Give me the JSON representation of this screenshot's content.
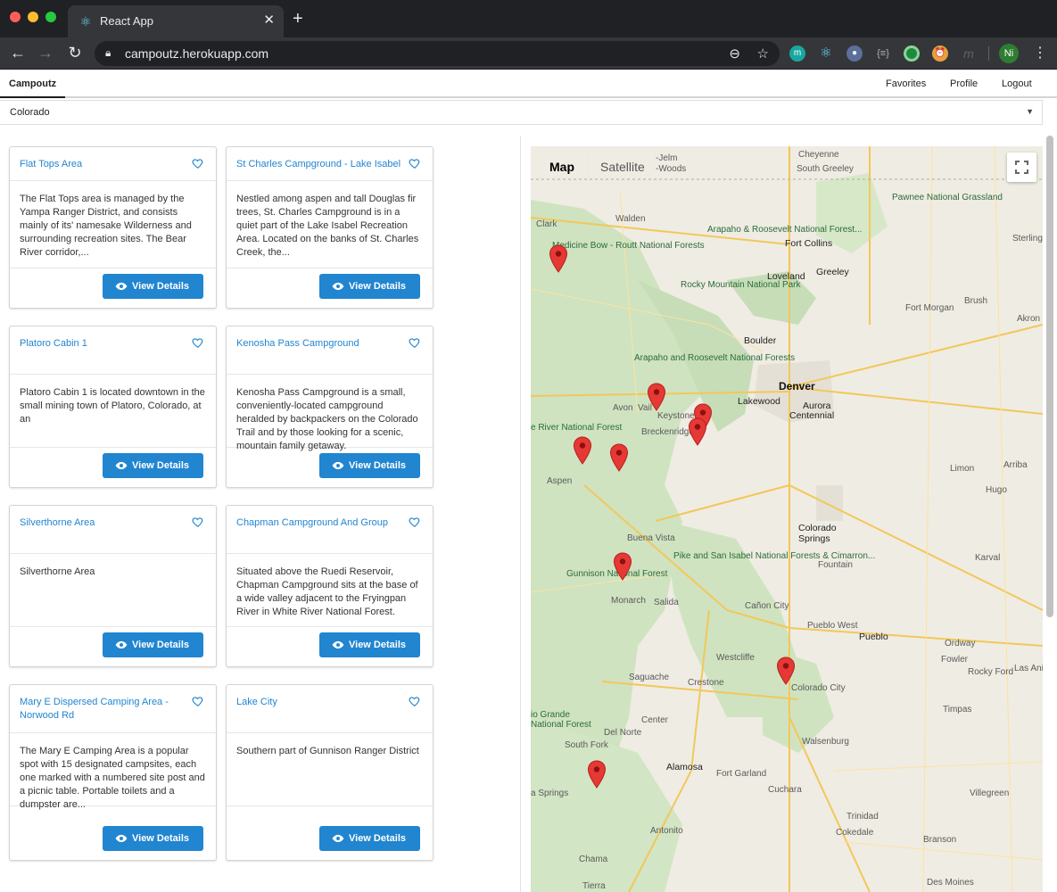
{
  "browser": {
    "tab_title": "React App",
    "tab_close": "✕",
    "new_tab": "+",
    "url": "campoutz.herokuapp.com",
    "profile_initials": "Ni",
    "extensions": [
      "m",
      "⚛",
      "●",
      "{≡}",
      "◎",
      "⏰",
      "m"
    ]
  },
  "app": {
    "brand": "Campoutz",
    "nav": {
      "favorites": "Favorites",
      "profile": "Profile",
      "logout": "Logout"
    },
    "state_select": {
      "value": "Colorado"
    },
    "view_details_label": "View Details"
  },
  "cards": [
    {
      "title": "Flat Tops Area",
      "desc": "The Flat Tops area is managed by the Yampa Ranger District, and consists mainly of its' namesake Wilderness and surrounding recreation sites. The Bear River corridor,..."
    },
    {
      "title": "St Charles Campground - Lake Isabel",
      "desc": "Nestled among aspen and tall Douglas fir trees, St. Charles Campground is in a quiet part of the Lake Isabel Recreation Area. Located on the banks of St. Charles Creek, the..."
    },
    {
      "title": "Platoro Cabin 1",
      "desc": "Platoro Cabin 1 is located downtown in the small mining town of Platoro, Colorado, at an"
    },
    {
      "title": "Kenosha Pass Campground",
      "desc": "Kenosha Pass Campground is a small, conveniently-located campground heralded by backpackers on the Colorado Trail and by those looking for a scenic, mountain family getaway."
    },
    {
      "title": "Silverthorne Area",
      "desc": "Silverthorne Area"
    },
    {
      "title": "Chapman Campground And Group",
      "desc": "Situated above the Ruedi Reservoir, Chapman Campground sits at the base of a wide valley adjacent to the Fryingpan River in White River National Forest."
    },
    {
      "title": "Mary E Dispersed Camping Area - Norwood Rd",
      "desc": "The Mary E Camping Area is a popular spot with 15 designated campsites, each one marked with a numbered site post and a picnic table. Portable toilets and a dumpster are..."
    },
    {
      "title": "Lake City",
      "desc": "Southern part of Gunnison Ranger District"
    }
  ],
  "map": {
    "type_buttons": {
      "map": "Map",
      "satellite": "Satellite"
    },
    "labels": {
      "cheyenne": "Cheyenne",
      "south_greeley": "South Greeley",
      "walden": "Walden",
      "fort_collins": "Fort Collins",
      "greeley": "Greeley",
      "loveland": "Loveland",
      "sterling": "Sterling",
      "fort_morgan": "Fort Morgan",
      "brush": "Brush",
      "akron": "Akron",
      "boulder": "Boulder",
      "denver": "Denver",
      "lakewood": "Lakewood",
      "aurora": "Aurora",
      "centennial": "Centennial",
      "avon": "Avon",
      "vail": "Vail",
      "keystone": "Keystone",
      "breckenridge": "Breckenridge",
      "aspen": "Aspen",
      "limon": "Limon",
      "arriba": "Arriba",
      "hugo": "Hugo",
      "colorado_springs": "Colorado Springs",
      "fountain": "Fountain",
      "buena_vista": "Buena Vista",
      "gunnison_nf": "Gunnison National Forest",
      "monarch": "Monarch",
      "salida": "Salida",
      "canon_city": "Cañon City",
      "pueblo_west": "Pueblo West",
      "pueblo": "Pueblo",
      "karval": "Karval",
      "ordway": "Ordway",
      "fowler": "Fowler",
      "rocky_ford": "Rocky Ford",
      "las_animas": "Las Anima",
      "westcliffe": "Westcliffe",
      "crestone": "Crestone",
      "saguache": "Saguache",
      "colorado_city": "Colorado City",
      "timpas": "Timpas",
      "walsenburg": "Walsenburg",
      "rio_grande": "io Grande",
      "national_forest": "National Forest",
      "del_norte": "Del Norte",
      "center": "Center",
      "south_fork": "South Fork",
      "alamosa": "Alamosa",
      "fort_garland": "Fort Garland",
      "cuchara": "Cuchara",
      "villegreen": "Villegreen",
      "trinidad": "Trinidad",
      "cokedale": "Cokedale",
      "branson": "Branson",
      "antonito": "Antonito",
      "chama": "Chama",
      "pagosa": "a Springs",
      "tierra": "Tierra",
      "des_moines": "Des Moines",
      "clark": "Clark",
      "pawnee": "Pawnee National Grassland",
      "arapaho_roosevelt_n": "Arapaho & Roosevelt National Forest...",
      "rmnp": "Rocky Mountain National Park",
      "arapaho_roosevelt_s": "Arapaho and Roosevelt National Forests",
      "pike_san_isabel": "Pike and San Isabel National Forests & Cimarron...",
      "medicine_bow": "Medicine Bow - Routt National Forests",
      "white_river": "e River National Forest",
      "jelm": "-Jelm",
      "wood_ds": "-Woods"
    }
  },
  "colors": {
    "accent": "#2185d0",
    "pin": "#e53935"
  }
}
